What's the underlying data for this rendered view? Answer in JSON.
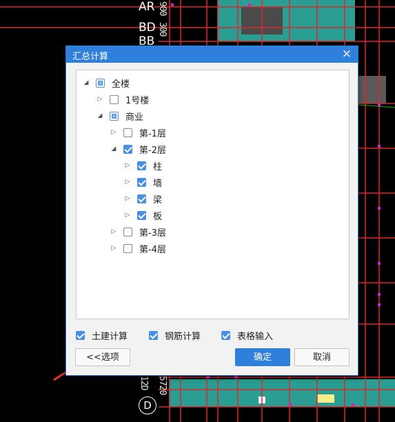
{
  "background": {
    "labels": [
      "AR",
      "BD",
      "BB",
      "D"
    ],
    "numbers": [
      "900",
      "300",
      "12D",
      "5720"
    ]
  },
  "dialog": {
    "title": "汇总计算",
    "close_glyph": "×",
    "tree": [
      {
        "label": "全楼",
        "state": "partial",
        "arrow": "expanded"
      },
      {
        "label": "1号楼",
        "state": "unchecked",
        "arrow": "collapsed"
      },
      {
        "label": "商业",
        "state": "partial",
        "arrow": "expanded"
      },
      {
        "label": "第-1层",
        "state": "unchecked",
        "arrow": "collapsed"
      },
      {
        "label": "第-2层",
        "state": "checked",
        "arrow": "expanded"
      },
      {
        "label": "柱",
        "state": "checked",
        "arrow": "collapsed"
      },
      {
        "label": "墙",
        "state": "checked",
        "arrow": "collapsed"
      },
      {
        "label": "梁",
        "state": "checked",
        "arrow": "collapsed"
      },
      {
        "label": "板",
        "state": "checked",
        "arrow": "collapsed"
      },
      {
        "label": "第-3层",
        "state": "unchecked",
        "arrow": "collapsed"
      },
      {
        "label": "第-4层",
        "state": "unchecked",
        "arrow": "collapsed"
      }
    ],
    "options": [
      {
        "label": "土建计算",
        "checked": true
      },
      {
        "label": "钢筋计算",
        "checked": true
      },
      {
        "label": "表格输入",
        "checked": true
      }
    ],
    "options_button": "<<选项",
    "ok_button": "确定",
    "cancel_button": "取消"
  },
  "colors": {
    "accent": "#2f7fdc",
    "annotation_arrow": "#e8342a",
    "grid_red": "#e0262a",
    "fill_teal": "#2a9e93"
  }
}
